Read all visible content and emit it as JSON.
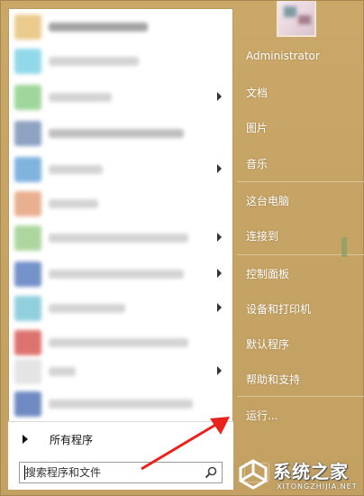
{
  "user": {
    "name": "Administrator"
  },
  "right_menu": {
    "documents": "文档",
    "pictures": "图片",
    "music": "音乐",
    "this_pc": "这台电脑",
    "connect_to": "连接到",
    "control_panel": "控制面板",
    "devices_printers": "设备和打印机",
    "default_programs": "默认程序",
    "help_support": "帮助和支持",
    "run": "运行..."
  },
  "left_panel": {
    "all_programs": "所有程序"
  },
  "search": {
    "placeholder": "搜索程序和文件"
  },
  "watermark": {
    "brand": "系统之家",
    "url": "XITONGZHIJIA.NET"
  },
  "colors": {
    "panel_bg": "#c6a466",
    "arrow_red": "#e8231c"
  },
  "icons": {
    "search": "magnifier-icon",
    "submenu": "chevron-right-icon"
  }
}
